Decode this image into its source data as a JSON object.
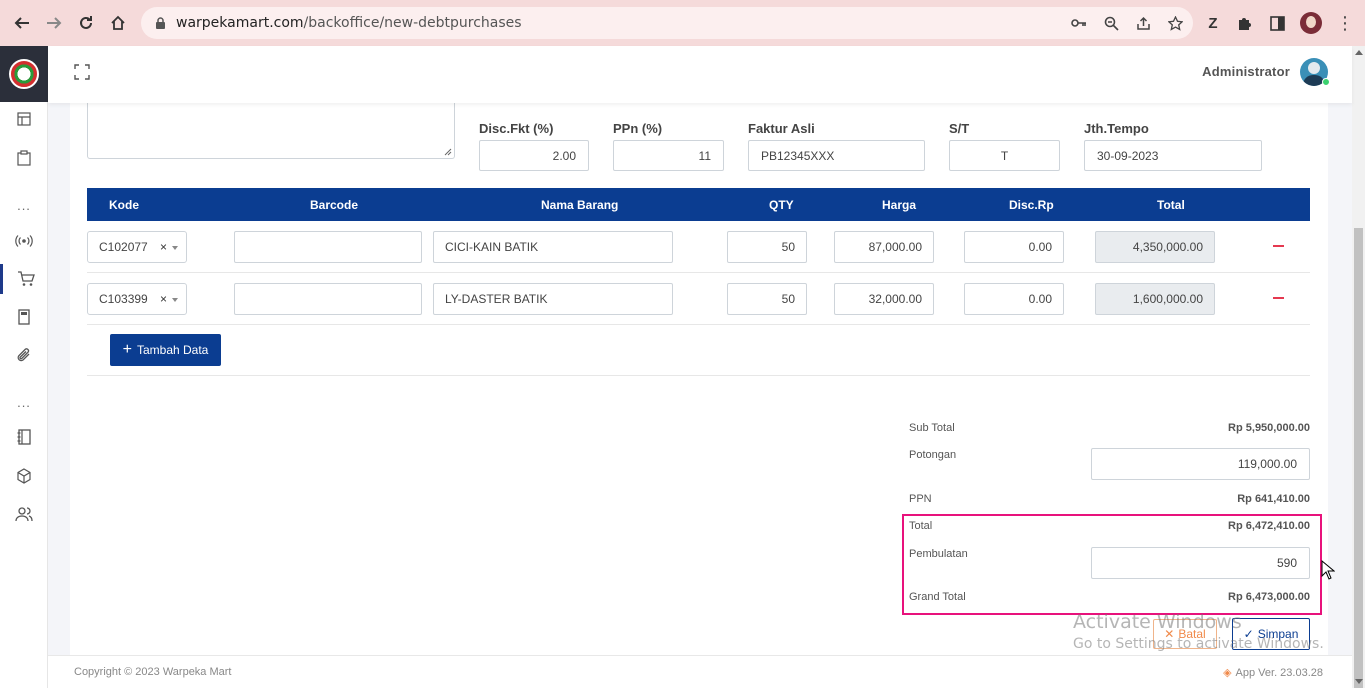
{
  "browser": {
    "url_host": "warpekamart.com",
    "url_path": "/backoffice/new-debtpurchases"
  },
  "header": {
    "user_name": "Administrator"
  },
  "form": {
    "disc_fkt": {
      "label": "Disc.Fkt (%)",
      "value": "2.00"
    },
    "ppn": {
      "label": "PPn (%)",
      "value": "11"
    },
    "faktur_asli": {
      "label": "Faktur Asli",
      "value": "PB12345XXX"
    },
    "st": {
      "label": "S/T",
      "value": "T"
    },
    "jth_tempo": {
      "label": "Jth.Tempo",
      "value": "30-09-2023"
    }
  },
  "table": {
    "columns": [
      "Kode",
      "Barcode",
      "Nama Barang",
      "QTY",
      "Harga",
      "Disc.Rp",
      "Total"
    ],
    "rows": [
      {
        "kode": "C102077",
        "barcode": "",
        "nama": "CICI-KAIN BATIK",
        "qty": "50",
        "harga": "87,000.00",
        "disc": "0.00",
        "total": "4,350,000.00"
      },
      {
        "kode": "C103399",
        "barcode": "",
        "nama": "LY-DASTER BATIK",
        "qty": "50",
        "harga": "32,000.00",
        "disc": "0.00",
        "total": "1,600,000.00"
      }
    ],
    "clear_symbol": "×",
    "add_label": "Tambah Data"
  },
  "summary": {
    "subtotal_label": "Sub Total",
    "subtotal_value": "Rp 5,950,000.00",
    "potongan_label": "Potongan",
    "potongan_value": "119,000.00",
    "ppn_label": "PPN",
    "ppn_value": "Rp 641,410.00",
    "total_label": "Total",
    "total_value": "Rp 6,472,410.00",
    "pembulatan_label": "Pembulatan",
    "pembulatan_value": "590",
    "grand_total_label": "Grand Total",
    "grand_total_value": "Rp 6,473,000.00"
  },
  "actions": {
    "batal_label": "Batal",
    "simpan_label": "Simpan"
  },
  "watermark": {
    "line1": "Activate Windows",
    "line2": "Go to Settings to activate Windows."
  },
  "footer": {
    "copyright": "Copyright © 2023 Warpeka Mart",
    "version": "App Ver. 23.03.28"
  },
  "colors": {
    "primary": "#0b3d91",
    "highlight": "#e8127c",
    "danger": "#e53950",
    "warning": "#f08a4b",
    "browser_bar": "#f5dada"
  }
}
